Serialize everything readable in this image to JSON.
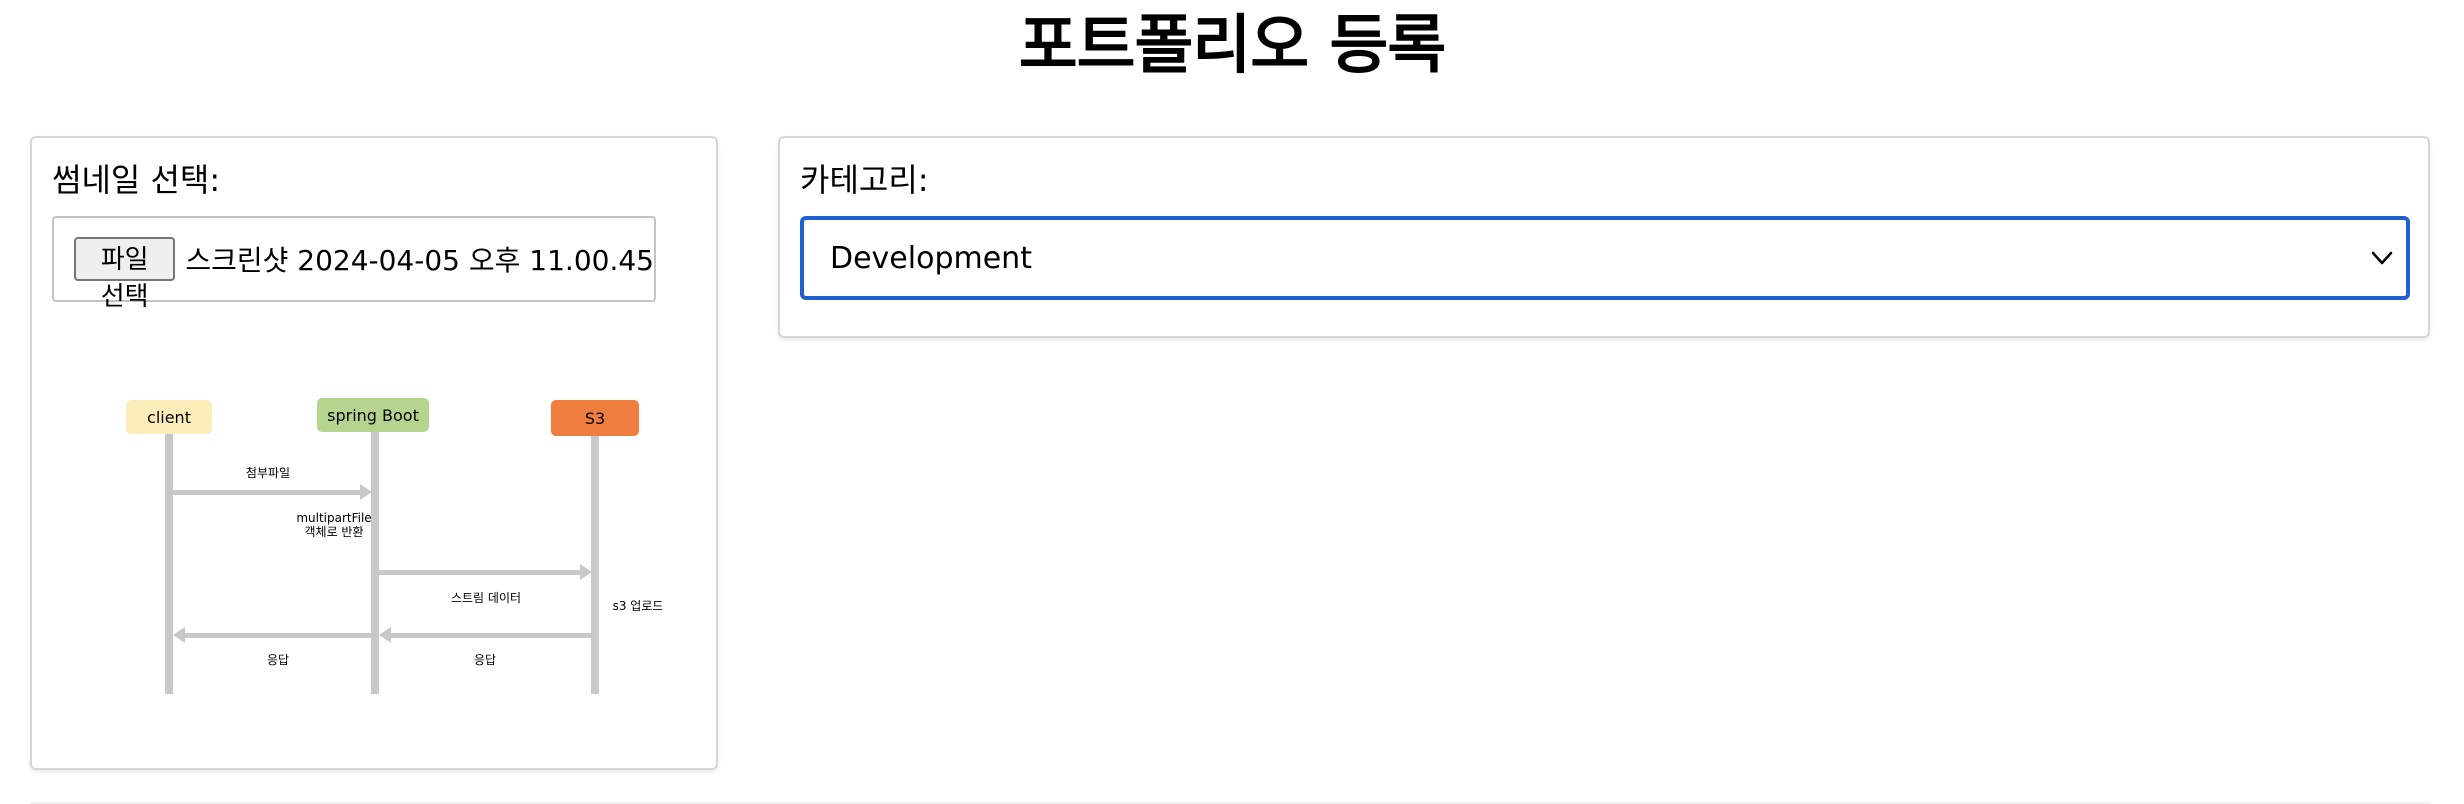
{
  "page": {
    "title": "포트폴리오 등록"
  },
  "thumbnail": {
    "label": "썸네일 선택:",
    "file_button_label": "파일 선택",
    "file_name": "스크린샷 2024-04-05 오후 11.00.45"
  },
  "diagram": {
    "actors": {
      "client": "client",
      "server": "spring Boot",
      "storage": "S3"
    },
    "messages": {
      "attach": "첨부파일",
      "convert_line1": "multipartFile",
      "convert_line2": "객체로 반환",
      "stream": "스트림 데이터",
      "upload": "s3 업로드",
      "response1": "응답",
      "response2": "응답"
    },
    "colors": {
      "client": "#fbeebb",
      "server": "#b5d48e",
      "storage": "#ef7d3f",
      "line": "#c8c8c8"
    }
  },
  "category": {
    "label": "카테고리:",
    "selected": "Development"
  }
}
